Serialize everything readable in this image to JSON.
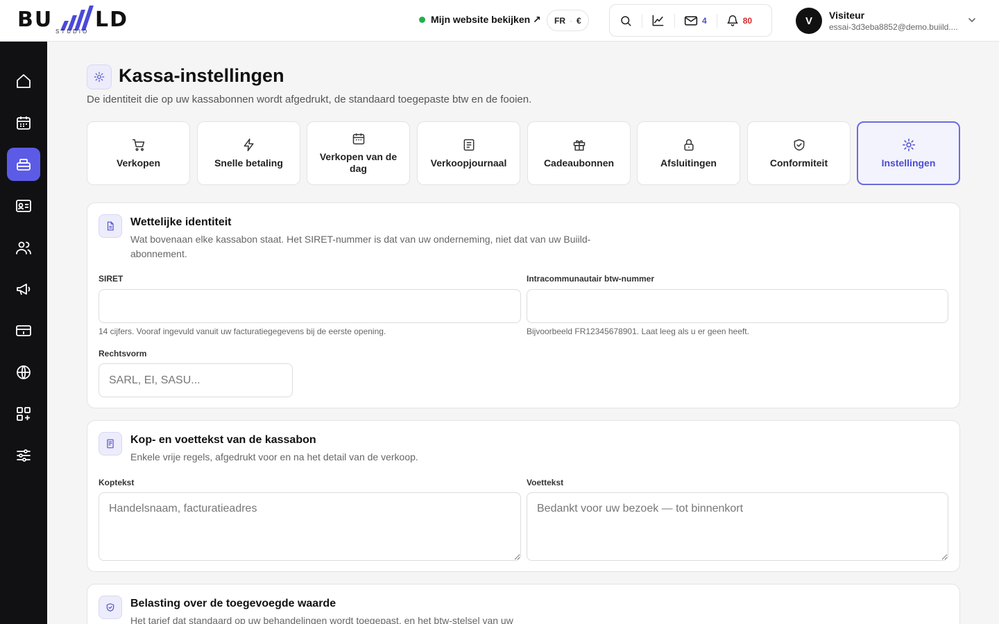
{
  "brand": {
    "word_left": "BU",
    "word_right": "LD",
    "sub": "STUDIO",
    "colors": {
      "accent": "#5b5be6",
      "bars": "#4a4ad8"
    }
  },
  "header": {
    "site_link": "Mijn website bekijken ↗",
    "lang": "FR",
    "currency": "€",
    "mail_count": "4",
    "notif_count": "80",
    "user": {
      "initial": "V",
      "name": "Visiteur",
      "email": "essai-3d3eba8852@demo.buiild...."
    }
  },
  "sidebar": {
    "items": [
      {
        "icon": "home-icon"
      },
      {
        "icon": "calendar-icon"
      },
      {
        "icon": "register-icon",
        "active": true
      },
      {
        "icon": "id-card-icon"
      },
      {
        "icon": "users-icon"
      },
      {
        "icon": "megaphone-icon"
      },
      {
        "icon": "card-icon"
      },
      {
        "icon": "globe-icon"
      },
      {
        "icon": "apps-icon"
      },
      {
        "icon": "sliders-icon"
      }
    ]
  },
  "page": {
    "title": "Kassa-instellingen",
    "subtitle": "De identiteit die op uw kassabonnen wordt afgedrukt, de standaard toegepaste btw en de fooien."
  },
  "tabs": [
    {
      "label": "Verkopen",
      "icon": "cart-icon"
    },
    {
      "label": "Snelle betaling",
      "icon": "bolt-icon"
    },
    {
      "label": "Verkopen van de dag",
      "icon": "calendar-icon"
    },
    {
      "label": "Verkoopjournaal",
      "icon": "journal-icon"
    },
    {
      "label": "Cadeaubonnen",
      "icon": "gift-icon"
    },
    {
      "label": "Afsluitingen",
      "icon": "lock-icon"
    },
    {
      "label": "Conformiteit",
      "icon": "shield-check-icon"
    },
    {
      "label": "Instellingen",
      "icon": "gear-icon",
      "active": true
    }
  ],
  "legal": {
    "title": "Wettelijke identiteit",
    "desc": "Wat bovenaan elke kassabon staat. Het SIRET-nummer is dat van uw onderneming, niet dat van uw Buiild-abonnement.",
    "siret_label": "SIRET",
    "siret_value": "",
    "siret_hint": "14 cijfers. Vooraf ingevuld vanuit uw facturatiegegevens bij de eerste opening.",
    "vat_label": "Intracommunautair btw-nummer",
    "vat_value": "",
    "vat_hint": "Bijvoorbeeld FR12345678901. Laat leeg als u er geen heeft.",
    "form_label": "Rechtsvorm",
    "form_placeholder": "SARL, EI, SASU..."
  },
  "receipt": {
    "title": "Kop- en voettekst van de kassabon",
    "desc": "Enkele vrije regels, afgedrukt voor en na het detail van de verkoop.",
    "header_label": "Koptekst",
    "header_placeholder": "Handelsnaam, facturatieadres",
    "footer_label": "Voettekst",
    "footer_placeholder": "Bedankt voor uw bezoek — tot binnenkort"
  },
  "vat": {
    "title": "Belasting over de toegevoegde waarde",
    "desc": "Het tarief dat standaard op uw behandelingen wordt toegepast, en het btw-stelsel van uw"
  }
}
